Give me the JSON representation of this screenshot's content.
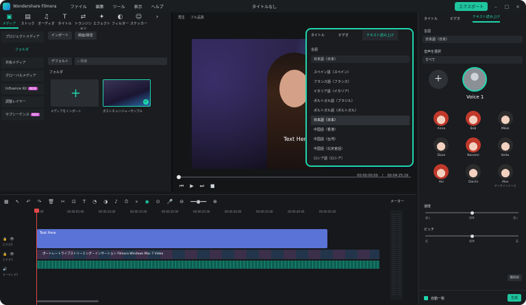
{
  "app": {
    "name": "Wondershare Filmora",
    "doc_title": "タイトルなし",
    "export_label": "エクスポート"
  },
  "menu": [
    "ファイル",
    "編集",
    "ツール",
    "表示",
    "ヘルプ"
  ],
  "toolbar": [
    {
      "label": "メディア",
      "icon": "media-icon"
    },
    {
      "label": "ストック",
      "icon": "stock-icon"
    },
    {
      "label": "オーディオ",
      "icon": "audio-icon"
    },
    {
      "label": "タイトル",
      "icon": "title-icon"
    },
    {
      "label": "トランジション",
      "icon": "transition-icon"
    },
    {
      "label": "エフェクト",
      "icon": "effect-icon"
    },
    {
      "label": "フィルター",
      "icon": "filter-icon"
    },
    {
      "label": "ステッカー",
      "icon": "sticker-icon"
    }
  ],
  "sidebar": {
    "items": [
      {
        "label": "プロジェクトメディア"
      },
      {
        "label": "フォルダ",
        "sub": true
      },
      {
        "label": "共有メディア"
      },
      {
        "label": "グローバルメディア"
      },
      {
        "label": "Influence Kit",
        "badge": "NEW"
      },
      {
        "label": "調整レイヤー"
      },
      {
        "label": "サブシーケンス",
        "badge": "NEW"
      }
    ]
  },
  "media": {
    "import_btn": "インポート",
    "record_btn": "録画/録音",
    "default_btn": "デフォルト",
    "search_placeholder": "検索",
    "folder_label": "フォルダ",
    "thumb1_label": "メディアをインポート",
    "thumb2_label": "ポストチュンジャーサンプル"
  },
  "preview": {
    "quality": "再生",
    "fit": "フル品質",
    "overlay_text": "Text Here",
    "time_current": "00:00:00:00",
    "time_total": "00:04:25:19"
  },
  "tts_popup": {
    "tabs": [
      "タイトル",
      "ビデオ",
      "テキスト読み上げ"
    ],
    "language_label": "言語",
    "language_value": "日本語（日本）",
    "options": [
      "スペイン語（スペイン）",
      "フランス語（フランス）",
      "イタリア語（イタリア）",
      "ポルトガル語（ブラジル）",
      "ポルトガル語（ポルトガル）",
      "日本語（日本）",
      "中国語（香港）",
      "中国語（台湾）",
      "中国語（北京官話）",
      "ロシア語（ロシア）"
    ],
    "selected_index": 5
  },
  "right_panel": {
    "tabs": [
      "タイトル",
      "ビデオ",
      "テキスト読み上げ"
    ],
    "lang_label": "言語",
    "lang_value": "日本語（日本）",
    "voice_filter_label": "音声を選択",
    "voice_filter_value": "すべて",
    "selected_voice": "Voice 1",
    "voices": [
      {
        "name": "Anna",
        "g": "f"
      },
      {
        "name": "Bob",
        "g": "m"
      },
      {
        "name": "Mikel",
        "g": "m"
      },
      {
        "name": "Dave",
        "g": "m"
      },
      {
        "name": "Nanami",
        "g": "f"
      },
      {
        "name": "Keita",
        "g": "m"
      },
      {
        "name": "Aoi",
        "g": "f"
      },
      {
        "name": "Daichi",
        "g": "m"
      },
      {
        "name": "Alex",
        "sub": "ヤングインテンス",
        "g": "m"
      }
    ],
    "speed_label": "速度",
    "speed_marks": [
      "遅く",
      "標準",
      "速く"
    ],
    "speed_value": 0.5,
    "pitch_label": "ピッチ",
    "pitch_marks": [
      "低",
      "標準",
      "高"
    ],
    "pitch_value": 0.5,
    "credits_btn": "無料枠",
    "auto_match_label": "自動一致",
    "generate_btn": "生成"
  },
  "timeline": {
    "ruler": [
      "00:00",
      "00:00:05:00",
      "00:00:10:00",
      "00:00:15:00",
      "00:00:20:00",
      "00:00:25:00",
      "00:00:30:00",
      "00:00:35:00",
      "00:00:40:00",
      "00:00:45:00"
    ],
    "meter_label": "メーター",
    "text_clip": "Text Here",
    "video_clip": "ポートレートライブストリーミング・インサーション Filmora Windows Mac 7 Video",
    "track_labels": [
      "ビデオ2",
      "ビデオ1",
      "オーディオ1"
    ]
  }
}
